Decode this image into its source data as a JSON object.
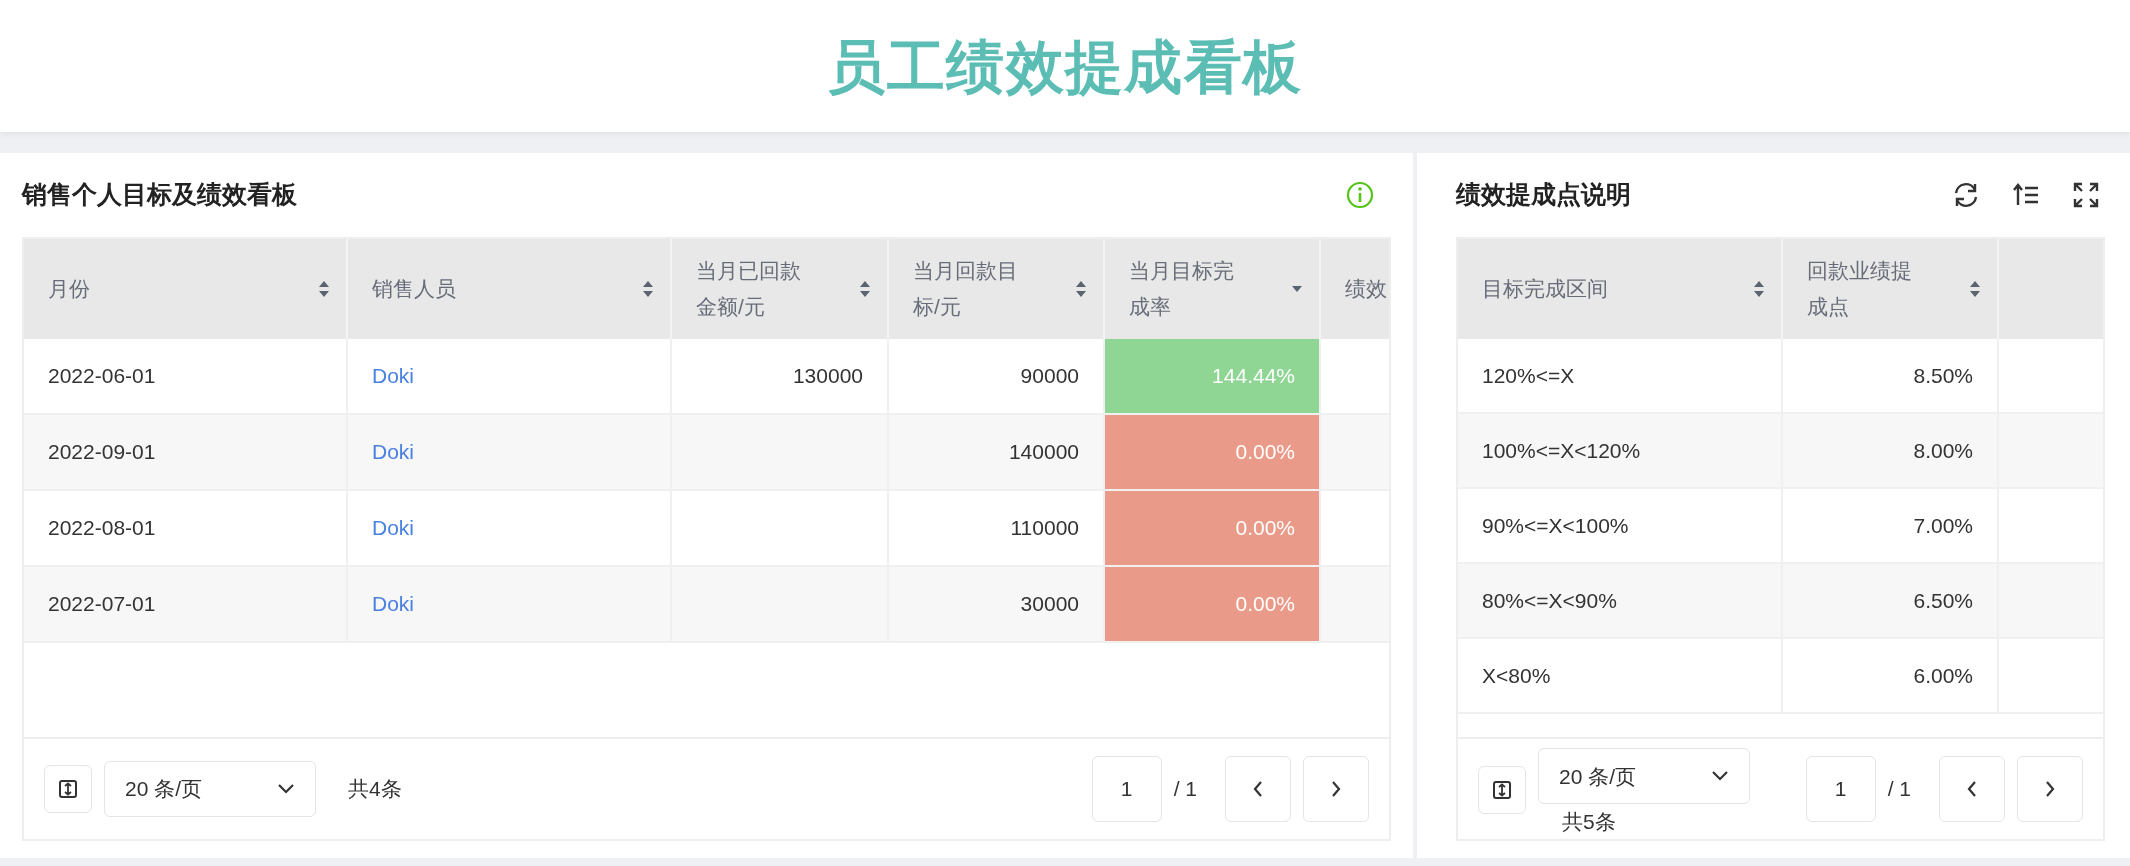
{
  "title": "员工绩效提成看板",
  "sales_panel": {
    "title": "销售个人目标及绩效看板",
    "table": {
      "columns": [
        {
          "label": "月份",
          "sortable": true,
          "sorted_descending": false
        },
        {
          "label": "销售人员",
          "sortable": true,
          "sorted_descending": false
        },
        {
          "label": "当月已回款金额/元",
          "sortable": true,
          "sorted_descending": false
        },
        {
          "label": "当月回款目标/元",
          "sortable": true,
          "sorted_descending": false
        },
        {
          "label": "当月目标完成率",
          "sortable": true,
          "sorted_descending": true
        },
        {
          "label": "绩效"
        }
      ],
      "rows": [
        {
          "month": "2022-06-01",
          "person": "Doki",
          "received": "130000",
          "target": "90000",
          "rate": "144.44%",
          "color": "#8fd694"
        },
        {
          "month": "2022-09-01",
          "person": "Doki",
          "received": "",
          "target": "140000",
          "rate": "0.00%",
          "color": "#e99a88"
        },
        {
          "month": "2022-08-01",
          "person": "Doki",
          "received": "",
          "target": "110000",
          "rate": "0.00%",
          "color": "#e99a88"
        },
        {
          "month": "2022-07-01",
          "person": "Doki",
          "received": "",
          "target": "30000",
          "rate": "0.00%",
          "color": "#e99a88"
        }
      ]
    },
    "pagination": {
      "page_size": "20 条/页",
      "total": "共4条",
      "page": "1",
      "pages": "/ 1"
    }
  },
  "rules_panel": {
    "title": "绩效提成点说明",
    "table": {
      "columns": [
        {
          "label": "目标完成区间",
          "sortable": true,
          "sorted_descending": false
        },
        {
          "label": "回款业绩提成点",
          "sortable": true,
          "sorted_descending": false
        }
      ],
      "rows": [
        {
          "range": "120%<=X",
          "rate": "8.50%"
        },
        {
          "range": "100%<=X<120%",
          "rate": "8.00%"
        },
        {
          "range": "90%<=X<100%",
          "rate": "7.00%"
        },
        {
          "range": "80%<=X<90%",
          "rate": "6.50%"
        },
        {
          "range": "X<80%",
          "rate": "6.00%"
        }
      ]
    },
    "pagination": {
      "page_size": "20 条/页",
      "total": "共5条",
      "page": "1",
      "pages": "/ 1"
    }
  }
}
